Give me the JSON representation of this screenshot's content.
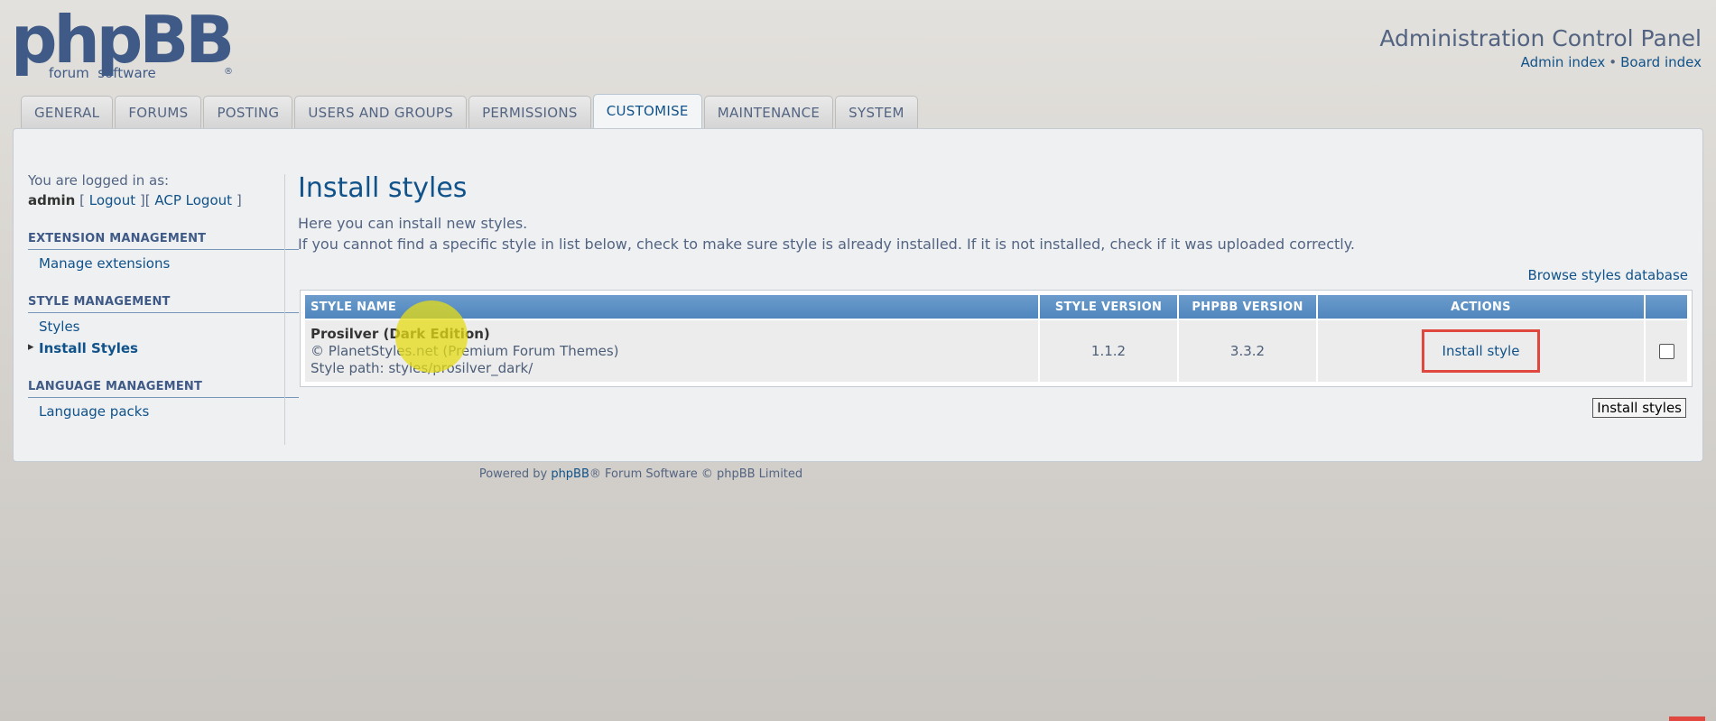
{
  "header": {
    "logo_main": "phpBB",
    "logo_sub": "forum  software",
    "logo_reg": "®",
    "acp_title": "Administration Control Panel",
    "links": {
      "admin_index": "Admin index",
      "separator": "•",
      "board_index": "Board index"
    }
  },
  "tabs": [
    {
      "label": "GENERAL"
    },
    {
      "label": "FORUMS"
    },
    {
      "label": "POSTING"
    },
    {
      "label": "USERS AND GROUPS"
    },
    {
      "label": "PERMISSIONS"
    },
    {
      "label": "CUSTOMISE",
      "active": true
    },
    {
      "label": "MAINTENANCE"
    },
    {
      "label": "SYSTEM"
    }
  ],
  "sidebar": {
    "logged_in_label": "You are logged in as:",
    "username": "admin",
    "logout_open": "[",
    "logout": "Logout",
    "mid_bracket": "][",
    "acp_logout": "ACP Logout",
    "logout_close": "]",
    "sections": [
      {
        "title": "EXTENSION MANAGEMENT",
        "items": [
          "Manage extensions"
        ]
      },
      {
        "title": "STYLE MANAGEMENT",
        "items": [
          "Styles",
          "Install Styles"
        ]
      },
      {
        "title": "LANGUAGE MANAGEMENT",
        "items": [
          "Language packs"
        ]
      }
    ]
  },
  "main": {
    "title": "Install styles",
    "desc1": "Here you can install new styles.",
    "desc2": "If you cannot find a specific style in list below, check to make sure style is already installed. If it is not installed, check if it was uploaded correctly.",
    "browse_link": "Browse styles database",
    "table": {
      "headers": [
        "STYLE NAME",
        "STYLE VERSION",
        "PHPBB VERSION",
        "ACTIONS"
      ],
      "rows": [
        {
          "name": "Prosilver (Dark Edition)",
          "copyright": "© PlanetStyles.net (Premium Forum Themes)",
          "path": "Style path: styles/prosilver_dark/",
          "style_version": "1.1.2",
          "phpbb_version": "3.3.2",
          "action": "Install style"
        }
      ]
    },
    "submit_label": "Install styles"
  },
  "footer": {
    "prefix": "Powered by ",
    "brand": "phpBB",
    "suffix": "® Forum Software © phpBB Limited"
  }
}
